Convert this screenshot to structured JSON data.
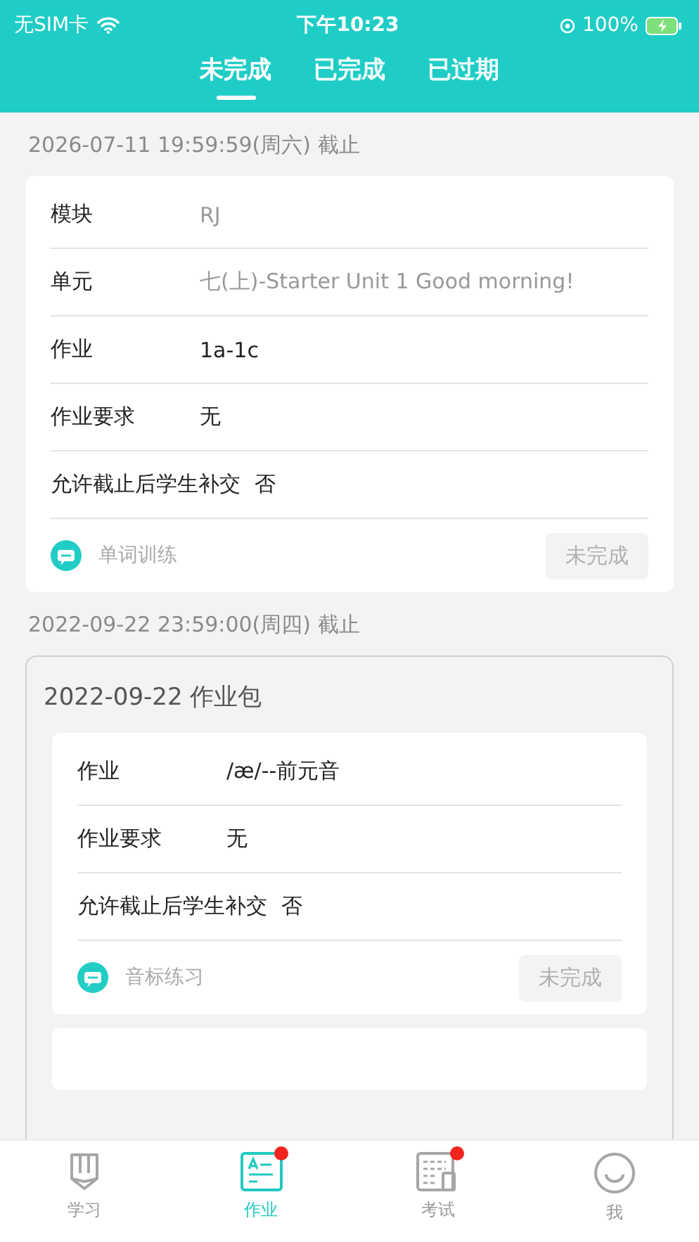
{
  "status_bar": {
    "carrier": "无SIM卡",
    "time": "下午10:23",
    "battery": "100%"
  },
  "tabs": [
    {
      "label": "未完成",
      "selected": true
    },
    {
      "label": "已完成",
      "selected": false
    },
    {
      "label": "已过期",
      "selected": false
    }
  ],
  "groups": [
    {
      "deadline": "2026-07-11 19:59:59(周六) 截止",
      "kind": "single",
      "cards": [
        {
          "rows": [
            {
              "label": "模块",
              "value": "RJ",
              "muted": true
            },
            {
              "label": "单元",
              "value": "七(上)-Starter Unit 1  Good morning!",
              "muted": true
            },
            {
              "label": "作业",
              "value": "1a-1c",
              "muted": false
            },
            {
              "label": "作业要求",
              "value": "无",
              "muted": false
            },
            {
              "label": "允许截止后学生补交",
              "value": "否",
              "muted": false
            }
          ],
          "type": "单词训练",
          "status": "未完成"
        }
      ]
    },
    {
      "deadline": "2022-09-22 23:59:00(周四) 截止",
      "kind": "package",
      "title": "2022-09-22 作业包",
      "cards": [
        {
          "rows": [
            {
              "label": "作业",
              "value": "/æ/--前元音",
              "muted": false
            },
            {
              "label": "作业要求",
              "value": "无",
              "muted": false
            },
            {
              "label": "允许截止后学生补交",
              "value": "否",
              "muted": false
            }
          ],
          "type": "音标练习",
          "status": "未完成"
        }
      ]
    }
  ],
  "nav": [
    {
      "label": "学习",
      "selected": false,
      "badge": false
    },
    {
      "label": "作业",
      "selected": true,
      "badge": true
    },
    {
      "label": "考试",
      "selected": false,
      "badge": true
    },
    {
      "label": "我",
      "selected": false,
      "badge": false
    }
  ]
}
